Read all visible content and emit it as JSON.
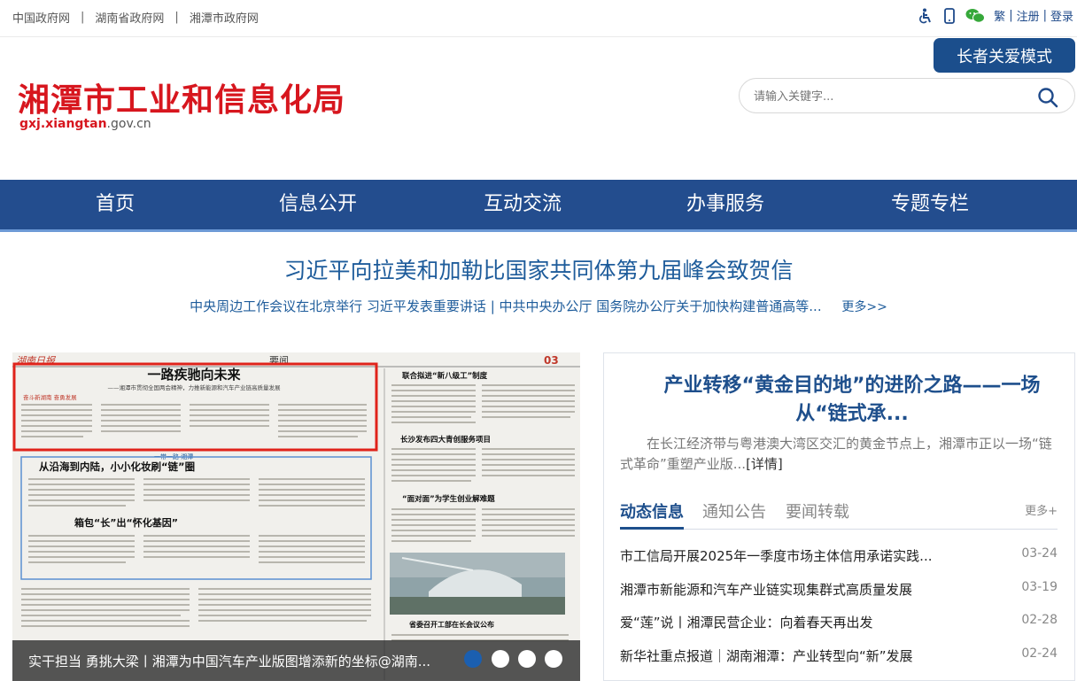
{
  "topbar": {
    "links": [
      "中国政府网",
      "湖南省政府网",
      "湘潭市政府网"
    ],
    "sep": "|",
    "right": {
      "trad": "繁",
      "register": "注册",
      "login": "登录",
      "bar": "|"
    }
  },
  "elder_mode": "长者关爱模式",
  "logo": {
    "title": "湘潭市工业和信息化局",
    "domain_bold": "gxj.xiangtan",
    "domain_rest": ".gov.cn"
  },
  "search": {
    "placeholder": "请输入关键字..."
  },
  "nav": [
    "首页",
    "信息公开",
    "互动交流",
    "办事服务",
    "专题专栏"
  ],
  "headline": "习近平向拉美和加勒比国家共同体第九届峰会致贺信",
  "subnews": {
    "text": "中央周边工作会议在北京举行 习近平发表重要讲话 | 中共中央办公厅 国务院办公厅关于加快构建普通高等...",
    "more": "更多>>"
  },
  "carousel": {
    "caption": "实干担当 勇挑大梁丨湘潭为中国汽车产业版图增添新的坐标@湖南...",
    "dots": 4,
    "active_dot": 0,
    "paper": {
      "masthead": "湖南日报",
      "section": "要闻",
      "page_no": "03",
      "main_head": "一路疾驰向未来",
      "sub_head": "——湘潭市贯彻全国两会精神，力推新能源和汽车产业链高质量发展",
      "tag1": "奋斗新湖南 奋勇发展",
      "head2": "从沿海到内陆，小小化妆刷“链”圈",
      "head3": "箱包“长”出“怀化基因”",
      "right_head1": "联合拟进“新八级工”制度",
      "right_head2": "长沙发布四大青创服务项目",
      "right_head3": "“面对面”为学生创业解难题",
      "right_head4": "省委召开工部在长会议公布",
      "tag2": "一带一路 湘潭"
    }
  },
  "feature": {
    "title": "产业转移“黄金目的地”的进阶之路——一场从“链式承...",
    "desc": "在长江经济带与粤港澳大湾区交汇的黄金节点上，湘潭市正以一场“链式革命”重塑产业版...",
    "detail": "[详情]"
  },
  "tabs": {
    "items": [
      "动态信息",
      "通知公告",
      "要闻转载"
    ],
    "active": 0,
    "more": "更多+"
  },
  "news": [
    {
      "title": "市工信局开展2025年一季度市场主体信用承诺实践...",
      "date": "03-24"
    },
    {
      "title": "湘潭市新能源和汽车产业链实现集群式高质量发展",
      "date": "03-19"
    },
    {
      "title": "爱“莲”说丨湘潭民营企业：向着春天再出发",
      "date": "02-28"
    },
    {
      "title": "新华社重点报道｜湖南湘潭：产业转型向“新”发展",
      "date": "02-24"
    }
  ],
  "colors": {
    "nav": "#234d8e",
    "brand_red": "#d7161e",
    "link_blue": "#1e5c9b"
  }
}
